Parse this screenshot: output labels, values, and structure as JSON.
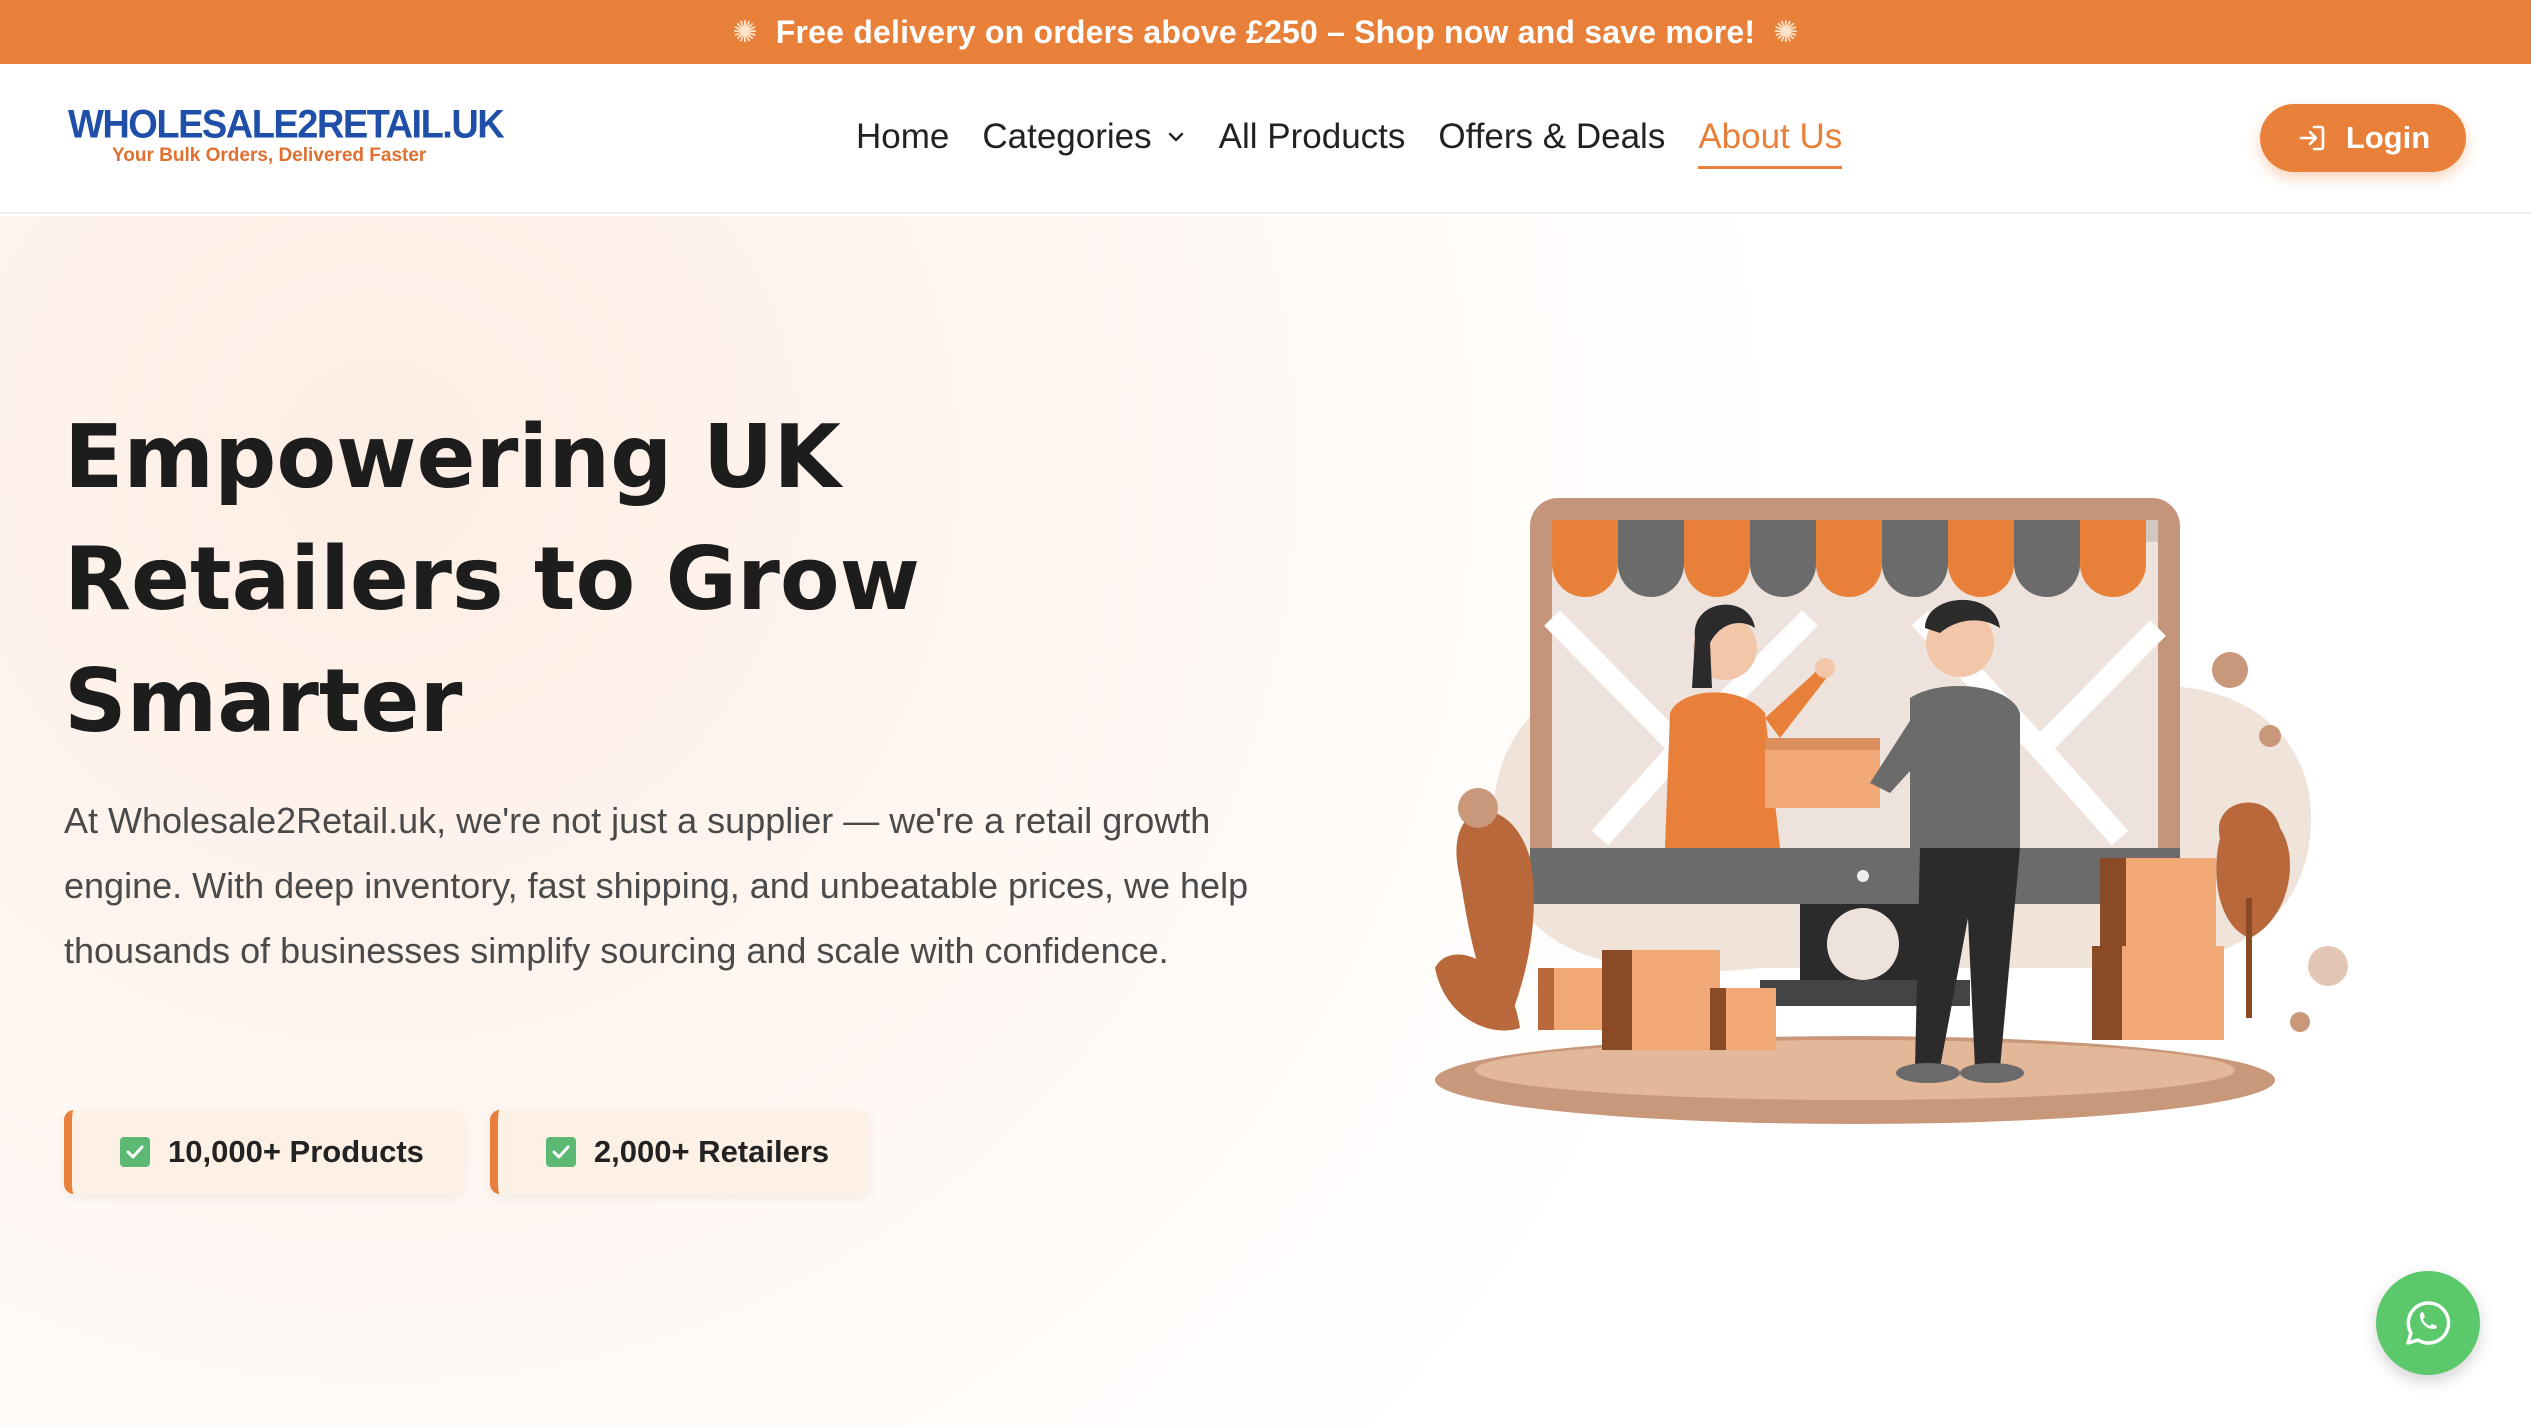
{
  "promo": {
    "text": "Free delivery on orders above £250 – Shop now and save more!",
    "icon_left": "party-popper-icon",
    "icon_right": "party-popper-icon"
  },
  "logo": {
    "name_part1": "WHOLESALE2",
    "name_part2": "RETAIL.UK",
    "tagline": "Your Bulk Orders, Delivered Faster"
  },
  "nav": {
    "items": [
      {
        "label": "Home"
      },
      {
        "label": "Categories"
      },
      {
        "label": "All Products"
      },
      {
        "label": "Offers & Deals"
      },
      {
        "label": "About Us"
      }
    ],
    "active": "About Us"
  },
  "login": {
    "label": "Login",
    "icon": "login-icon"
  },
  "hero": {
    "title_line1": "Empowering UK",
    "title_line2": "Retailers to Grow",
    "title_line3": "Smarter",
    "text": "At Wholesale2Retail.uk, we're not just a supplier — we're a retail growth engine. With deep inventory, fast shipping, and unbeatable prices, we help thousands of businesses simplify sourcing and scale with confidence.",
    "badges": [
      {
        "label": "10,000+ Products"
      },
      {
        "label": "2,000+ Retailers"
      }
    ]
  },
  "whatsapp": {
    "icon": "whatsapp-icon"
  },
  "colors": {
    "accent": "#E8803A",
    "brand_blue": "#1F4FA8",
    "whatsapp": "#5CC86C"
  }
}
